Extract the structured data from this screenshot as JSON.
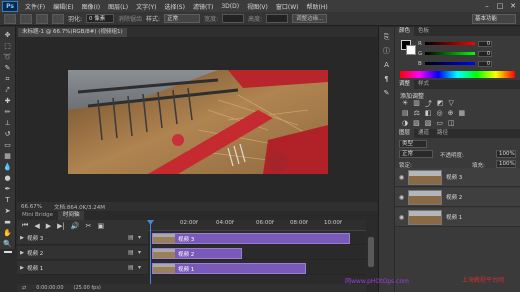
{
  "menubar": {
    "logo": "Ps",
    "items": [
      "文件(F)",
      "编辑(E)",
      "图像(I)",
      "图层(L)",
      "文字(Y)",
      "选择(S)",
      "滤镜(T)",
      "3D(D)",
      "视图(V)",
      "窗口(W)",
      "帮助(H)"
    ]
  },
  "options": {
    "feather_label": "羽化:",
    "feather_value": "0 像素",
    "antialias_label": "消除锯齿",
    "style_label": "样式:",
    "style_value": "正常",
    "width_label": "宽度:",
    "height_label": "高度:",
    "refine_button": "调整边缘...",
    "workspace": "基本功能"
  },
  "document": {
    "tab_title": "未标题-1 @ 66.7%(RGB/8#) (视频组1)",
    "zoom": "66.67%",
    "doc_info": "文档:864.0K/3.24M"
  },
  "timeline": {
    "tabs": [
      "Mini Bridge",
      "时间轴"
    ],
    "ruler_ticks": [
      "02:00f",
      "04:00f",
      "06:00f",
      "08:00f",
      "10:00f"
    ],
    "tracks": [
      {
        "name": "视频 3",
        "clip": "视频 3"
      },
      {
        "name": "视频 2",
        "clip": "视频 2"
      },
      {
        "name": "视频 1",
        "clip": "视频 1"
      }
    ],
    "timecode": "0:00:00:00",
    "fps": "(25.00 fps)"
  },
  "color_panel": {
    "tabs": [
      "颜色",
      "色板"
    ],
    "channels": [
      {
        "label": "R",
        "value": "0",
        "color": "#ff0000"
      },
      {
        "label": "G",
        "value": "0",
        "color": "#00ff00"
      },
      {
        "label": "B",
        "value": "0",
        "color": "#0000ff"
      }
    ]
  },
  "adjust_panel": {
    "tabs": [
      "调整",
      "样式"
    ],
    "title": "添加调整"
  },
  "layers_panel": {
    "tabs": [
      "图层",
      "通道",
      "路径"
    ],
    "kind_label": "类型",
    "blend_mode": "正常",
    "opacity_label": "不透明度:",
    "opacity_value": "100%",
    "lock_label": "锁定:",
    "fill_label": "填充:",
    "fill_value": "100%",
    "layers": [
      "视频 3",
      "视频 2",
      "视频 1"
    ]
  },
  "watermark": {
    "text1": "网www.pHOtOps.com",
    "text2": "上海教程平台网"
  },
  "colors": {
    "accent": "#4a86d8",
    "clip": "#7a5ab8"
  }
}
